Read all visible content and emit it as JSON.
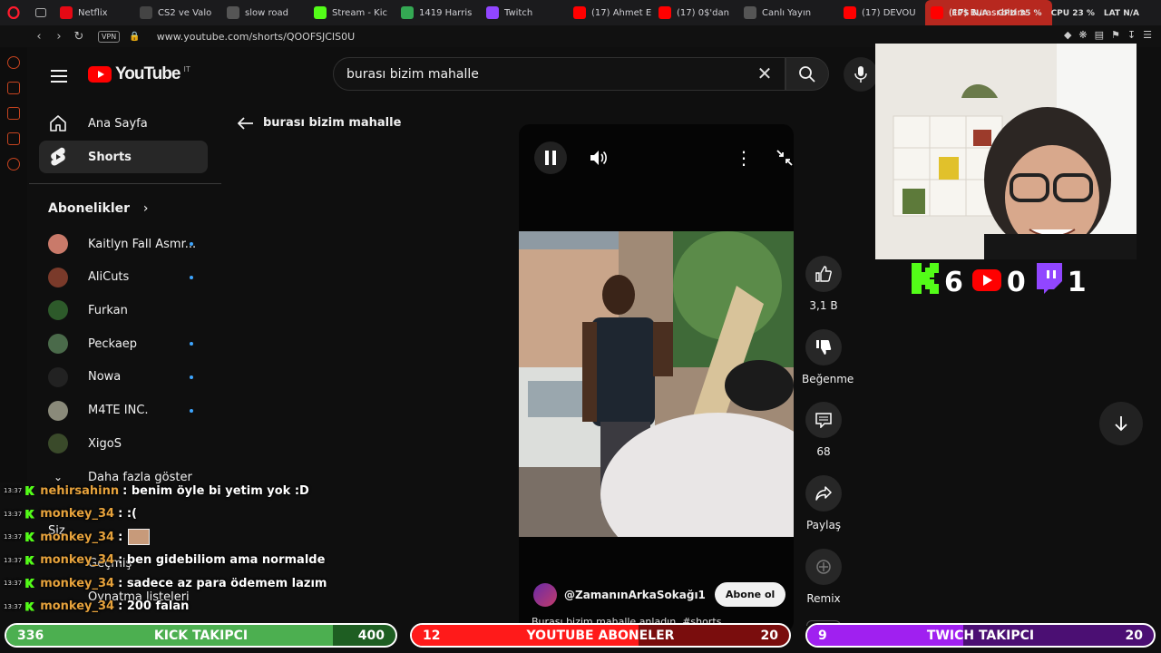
{
  "browser": {
    "tabs": [
      {
        "label": "Netflix",
        "icon": "netflix-icon",
        "color": "#e50914"
      },
      {
        "label": "CS2 ve Valo",
        "icon": "page-icon",
        "color": "#444"
      },
      {
        "label": "slow road",
        "icon": "globe-icon",
        "color": "#555"
      },
      {
        "label": "Stream - Kic",
        "icon": "kick-icon",
        "color": "#53fc18"
      },
      {
        "label": "1419 Harris",
        "icon": "maps-icon",
        "color": "#34a853"
      },
      {
        "label": "Twitch",
        "icon": "twitch-icon",
        "color": "#9146ff"
      },
      {
        "label": "(17) Ahmet E",
        "icon": "youtube-icon",
        "color": "#ff0000"
      },
      {
        "label": "(17) 0$'dan",
        "icon": "youtube-icon",
        "color": "#ff0000"
      },
      {
        "label": "Canlı Yayın",
        "icon": "page-icon",
        "color": "#555"
      },
      {
        "label": "(17) DEVOU",
        "icon": "youtube-icon",
        "color": "#ff0000"
      },
      {
        "label": "(17) Burası bizim",
        "icon": "youtube-icon",
        "color": "#ff0000",
        "active": true
      }
    ],
    "url": "www.youtube.com/shorts/QOOFSJCIS0U",
    "vpn": "VPN",
    "stats": {
      "fps_label": "FPS",
      "fps": "N/A",
      "gpu_label": "GPU",
      "gpu": "35 %",
      "cpu_label": "CPU",
      "cpu": "23 %",
      "lat_label": "LAT",
      "lat": "N/A"
    }
  },
  "youtube": {
    "logo": "YouTube",
    "country": "IT",
    "search_query": "burası bizim mahalle",
    "nav": [
      {
        "label": "Ana Sayfa",
        "icon": "home-icon"
      },
      {
        "label": "Shorts",
        "icon": "shorts-icon",
        "selected": true
      }
    ],
    "subscriptions_header": "Abonelikler",
    "subscriptions": [
      {
        "name": "Kaitlyn Fall Asmr...",
        "dot": true,
        "color": "#c97a6a"
      },
      {
        "name": "AliCuts",
        "dot": true,
        "color": "#7a3a2a"
      },
      {
        "name": "Furkan",
        "dot": false,
        "color": "#2d5a2a"
      },
      {
        "name": "Peckaep",
        "dot": true,
        "color": "#4a6a4a"
      },
      {
        "name": "Nowa",
        "dot": true,
        "color": "#222"
      },
      {
        "name": "M4TE INC.",
        "dot": true,
        "color": "#8a8a7a"
      },
      {
        "name": "XigoS",
        "dot": false,
        "color": "#3a4a2a"
      }
    ],
    "show_more": "Daha fazla göster",
    "you_section": "Siz",
    "history": "Geçmiş",
    "playlists": "Oynatma listeleri",
    "back_title": "burası bizim mahalle",
    "short": {
      "likes": "3,1 B",
      "dislike_label": "Beğenme",
      "comments": "68",
      "share_label": "Paylaş",
      "remix_label": "Remix",
      "channel": "@ZamanınArkaSokağı1",
      "subscribe": "Abone ol",
      "caption": "Burası bizim mahalle anladın. #shorts"
    }
  },
  "stream_overlay": {
    "counters": [
      {
        "platform": "kick",
        "value": "6",
        "color": "#53fc18"
      },
      {
        "platform": "youtube",
        "value": "0",
        "color": "#ff0000"
      },
      {
        "platform": "twitch",
        "value": "1",
        "color": "#9146ff"
      }
    ],
    "chat": [
      {
        "time": "13:37",
        "user": "nehirsahinn",
        "text": ": benim öyle bi yetim yok :D"
      },
      {
        "time": "13:37",
        "user": "monkey_34",
        "text": ": :("
      },
      {
        "time": "13:37",
        "user": "monkey_34",
        "text": ":",
        "emote": true
      },
      {
        "time": "13:37",
        "user": "monkey_34",
        "text": ": ben gidebiliom ama normalde"
      },
      {
        "time": "13:37",
        "user": "monkey_34",
        "text": ": sadece az para ödemem lazım"
      },
      {
        "time": "13:37",
        "user": "monkey_34",
        "text": ": 200 falan"
      }
    ],
    "goals": [
      {
        "current": "336",
        "label": "KICK TAKIPCI",
        "target": "400",
        "progress": 0.84,
        "color": "#4caf50",
        "track": "#1e5e22"
      },
      {
        "current": "12",
        "label": "YOUTUBE ABONELER",
        "target": "20",
        "progress": 0.6,
        "color": "#ff1a1a",
        "track": "#7a0d0d"
      },
      {
        "current": "9",
        "label": "TWICH TAKIPCI",
        "target": "20",
        "progress": 0.45,
        "color": "#a020f0",
        "track": "#4b0f73"
      }
    ]
  }
}
